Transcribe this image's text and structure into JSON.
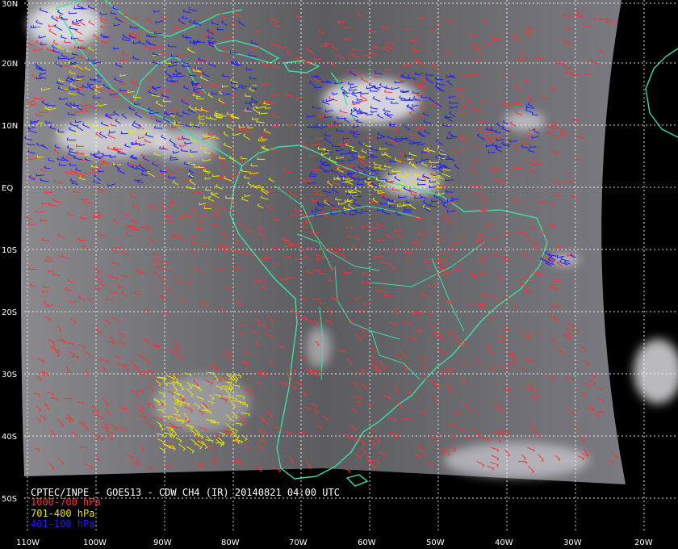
{
  "title": "CPTEC/INPE - GOES13 - CDW CH4 (IR) 20140821 04:00 UTC",
  "legend": [
    {
      "label": "1000-700 hPa",
      "color": "#ff3030"
    },
    {
      "label": "701-400 hPa",
      "color": "#e6e600"
    },
    {
      "label": "401-100 hPa",
      "color": "#1e1eff"
    }
  ],
  "latitude_labels": [
    "30N",
    "20N",
    "10N",
    "EQ",
    "10S",
    "20S",
    "30S",
    "40S",
    "50S"
  ],
  "longitude_labels": [
    "110W",
    "100W",
    "90W",
    "80W",
    "70W",
    "60W",
    "50W",
    "40W",
    "30W",
    "20W"
  ],
  "colors": {
    "background": "#000000",
    "coastline": "#3ce0a0",
    "grid": "#ffffff",
    "cloud_top": "#e8e8ec",
    "sea_surface": "#6a6a6e"
  }
}
